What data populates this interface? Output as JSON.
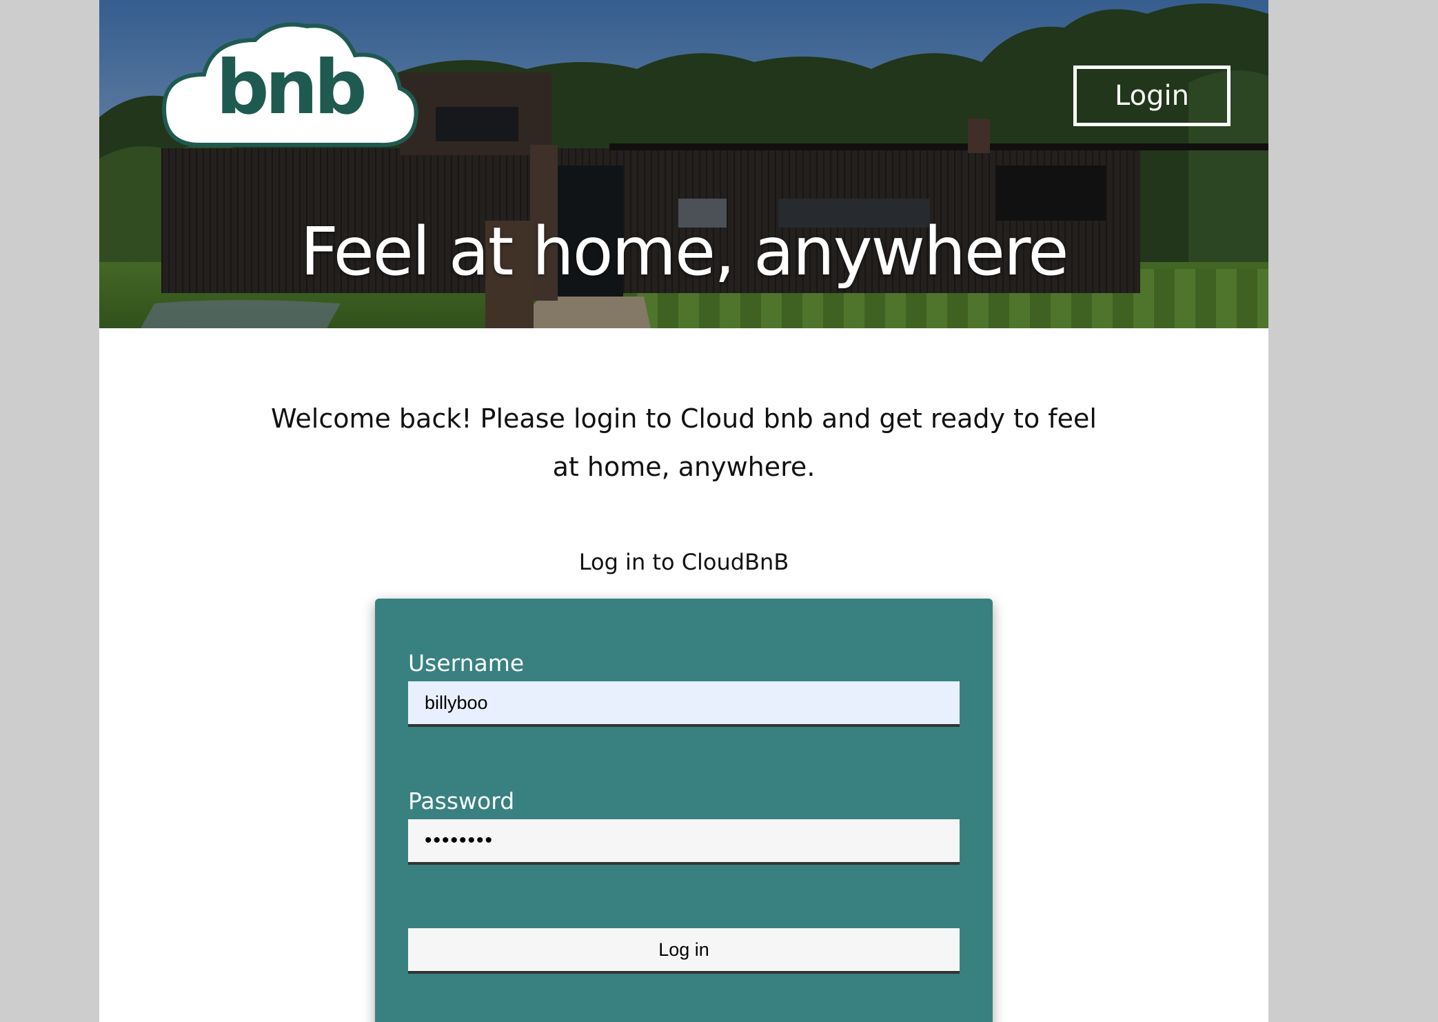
{
  "header": {
    "logo_text": "bnb",
    "login_link": "Login",
    "hero_title": "Feel at home, anywhere"
  },
  "main": {
    "welcome_text": "Welcome back! Please login to Cloud bnb and get ready to feel at home, anywhere.",
    "form_heading": "Log in to CloudBnB"
  },
  "login_form": {
    "username_label": "Username",
    "username_value": "billyboo",
    "password_label": "Password",
    "password_value": "password",
    "submit_label": "Log in"
  },
  "colors": {
    "brand_green": "#1f5a50",
    "card_teal": "#388180",
    "autofill_blue": "#e8f0fe",
    "page_gray": "#cdcdcd"
  }
}
